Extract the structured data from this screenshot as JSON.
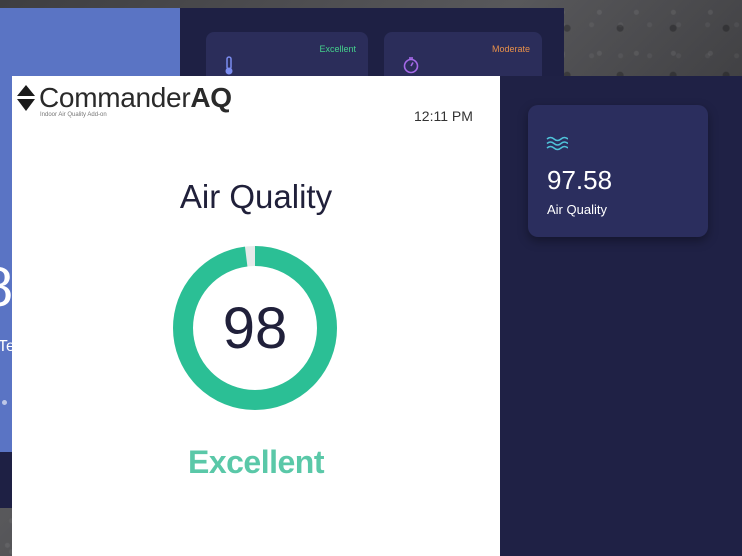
{
  "back_screen": {
    "big_digit": "8",
    "small_text": "Te",
    "cards": [
      {
        "status": "Excellent",
        "icon": "thermometer-icon"
      },
      {
        "status": "Moderate",
        "icon": "timer-icon"
      }
    ]
  },
  "header": {
    "logo_light": "Commander",
    "logo_bold": "AQ",
    "subtitle": "Indoor Air Quality Add-on",
    "time": "12:11 PM"
  },
  "main": {
    "title": "Air Quality",
    "score": "98",
    "status": "Excellent"
  },
  "metric_card": {
    "icon": "wave-icon",
    "value": "97.58",
    "label": "Air Quality"
  },
  "colors": {
    "accent_green": "#2bbf95",
    "status_text": "#5ac8a8",
    "dark_panel": "#1f2145",
    "card": "#2b2e5e",
    "wave_icon": "#4fc3d9",
    "back_blue": "#5a74c4",
    "excellent": "#44d18c",
    "moderate": "#e8904a"
  },
  "gauge": {
    "fraction": 0.98
  }
}
